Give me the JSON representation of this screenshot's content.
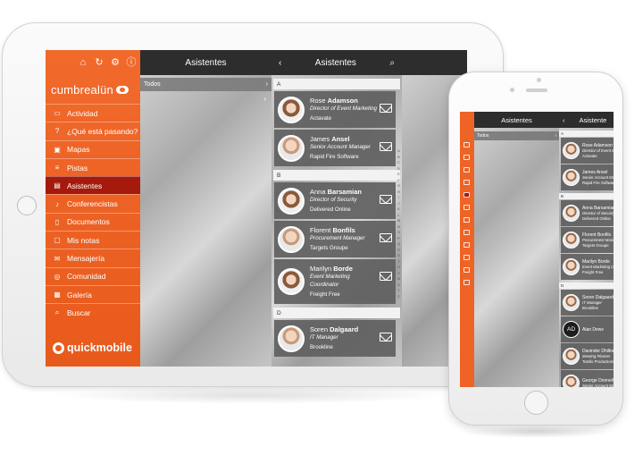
{
  "sidebar": {
    "top_icons": [
      "home-icon",
      "refresh-icon",
      "gear-icon",
      "info-icon"
    ],
    "brand": "cumbrealün",
    "items": [
      {
        "label": "Actividad",
        "icon": "activity-icon",
        "active": false
      },
      {
        "label": "¿Qué está pasando?",
        "icon": "question-icon",
        "active": false
      },
      {
        "label": "Mapas",
        "icon": "map-icon",
        "active": false
      },
      {
        "label": "Pistas",
        "icon": "list-icon",
        "active": false
      },
      {
        "label": "Asistentes",
        "icon": "attendees-icon",
        "active": true
      },
      {
        "label": "Conferencistas",
        "icon": "microphone-icon",
        "active": false
      },
      {
        "label": "Documentos",
        "icon": "document-icon",
        "active": false
      },
      {
        "label": "Mis notas",
        "icon": "notes-icon",
        "active": false
      },
      {
        "label": "Mensajería",
        "icon": "message-icon",
        "active": false
      },
      {
        "label": "Comunidad",
        "icon": "community-icon",
        "active": false
      },
      {
        "label": "Galería",
        "icon": "gallery-icon",
        "active": false
      },
      {
        "label": "Buscar",
        "icon": "search-icon",
        "active": false
      }
    ],
    "logo": "quickmobile",
    "accent": "#f16a2c",
    "active_color": "#a51a0c"
  },
  "panel1": {
    "title": "Asistentes",
    "rows": [
      {
        "label": "Todos"
      }
    ]
  },
  "panel2": {
    "title": "Asistentes",
    "sections": [
      {
        "letter": "A",
        "people": [
          {
            "first": "Rose",
            "last": "Adamson",
            "role": "Director of Event Marketing",
            "company": "Actavate"
          },
          {
            "first": "James",
            "last": "Ansel",
            "role": "Senior Account Manager",
            "company": "Rapid Fire Software"
          }
        ]
      },
      {
        "letter": "B",
        "people": [
          {
            "first": "Anna",
            "last": "Barsamian",
            "role": "Director of Security",
            "company": "Delivered Online"
          },
          {
            "first": "Florent",
            "last": "Bonfils",
            "role": "Procurement Manager",
            "company": "Targets Groupe"
          },
          {
            "first": "Marilyn",
            "last": "Borde",
            "role": "Event Marketing Coordinator",
            "company": "Freight Free"
          }
        ]
      },
      {
        "letter": "D",
        "people": [
          {
            "first": "Soren",
            "last": "Dalgaard",
            "role": "IT Manager",
            "company": "Brookline"
          }
        ]
      }
    ],
    "alphabet": "ABCDEFGHIJKLMNOPQRSTUVWXYZ"
  },
  "phone": {
    "panel1_title": "Asistentes",
    "panel1_row": "Todos",
    "panel2_title": "Asistente",
    "sections": [
      {
        "letter": "A",
        "people": [
          {
            "name": "Rose Adamson",
            "role": "Director of Event Marketing",
            "company": "Actavate"
          },
          {
            "name": "James Ansel",
            "role": "Senior Account Manager",
            "company": "Rapid Fire Software"
          }
        ]
      },
      {
        "letter": "B",
        "people": [
          {
            "name": "Anna Barsamian",
            "role": "Director of Security",
            "company": "Delivered Online"
          },
          {
            "name": "Florent Bonfils",
            "role": "Procurement Manager",
            "company": "Targets Groupe"
          },
          {
            "name": "Marilyn Borde",
            "role": "Event Marketing Coordinator",
            "company": "Freight Free"
          }
        ]
      },
      {
        "letter": "D",
        "people": [
          {
            "name": "Soren Dalgaard",
            "role": "IT Manager",
            "company": "Brookline"
          },
          {
            "name": "Alan Dews",
            "role": "",
            "company": "",
            "initials": "AD"
          },
          {
            "name": "Davinder Dhillon",
            "role": "Meeting Planner",
            "company": "Totello Productions"
          },
          {
            "name": "George Donnelly",
            "role": "Senior Account Manager",
            "company": ""
          }
        ]
      }
    ]
  }
}
